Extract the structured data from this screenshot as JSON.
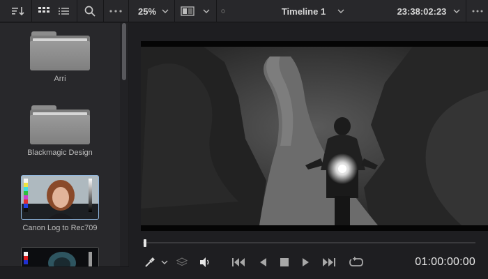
{
  "toolbar": {
    "sort_icon": "sort-descending-icon",
    "grid_view_icon": "grid-view-icon",
    "list_view_icon": "list-view-icon",
    "search_icon": "search-icon",
    "more_icon": "more-options-icon",
    "zoom_level": "25%",
    "layout_icon": "viewer-layout-icon",
    "timeline_name": "Timeline 1",
    "timecode": "23:38:02:23",
    "accent_color": "#d6d6d6"
  },
  "media_pool": {
    "items": [
      {
        "type": "folder",
        "label": "Arri"
      },
      {
        "type": "folder",
        "label": "Blackmagic Design"
      },
      {
        "type": "lut",
        "label": "Canon Log to Rec709"
      },
      {
        "type": "lut",
        "label": ""
      }
    ]
  },
  "transport": {
    "picker_icon": "color-picker-icon",
    "layers_icon": "layers-icon",
    "volume_icon": "volume-icon",
    "first_frame_icon": "skip-to-start-icon",
    "reverse_icon": "play-reverse-icon",
    "stop_icon": "stop-icon",
    "play_icon": "play-icon",
    "last_frame_icon": "skip-to-end-icon",
    "loop_icon": "loop-icon",
    "timecode": "01:00:00:00",
    "playhead_position": 0.0
  }
}
